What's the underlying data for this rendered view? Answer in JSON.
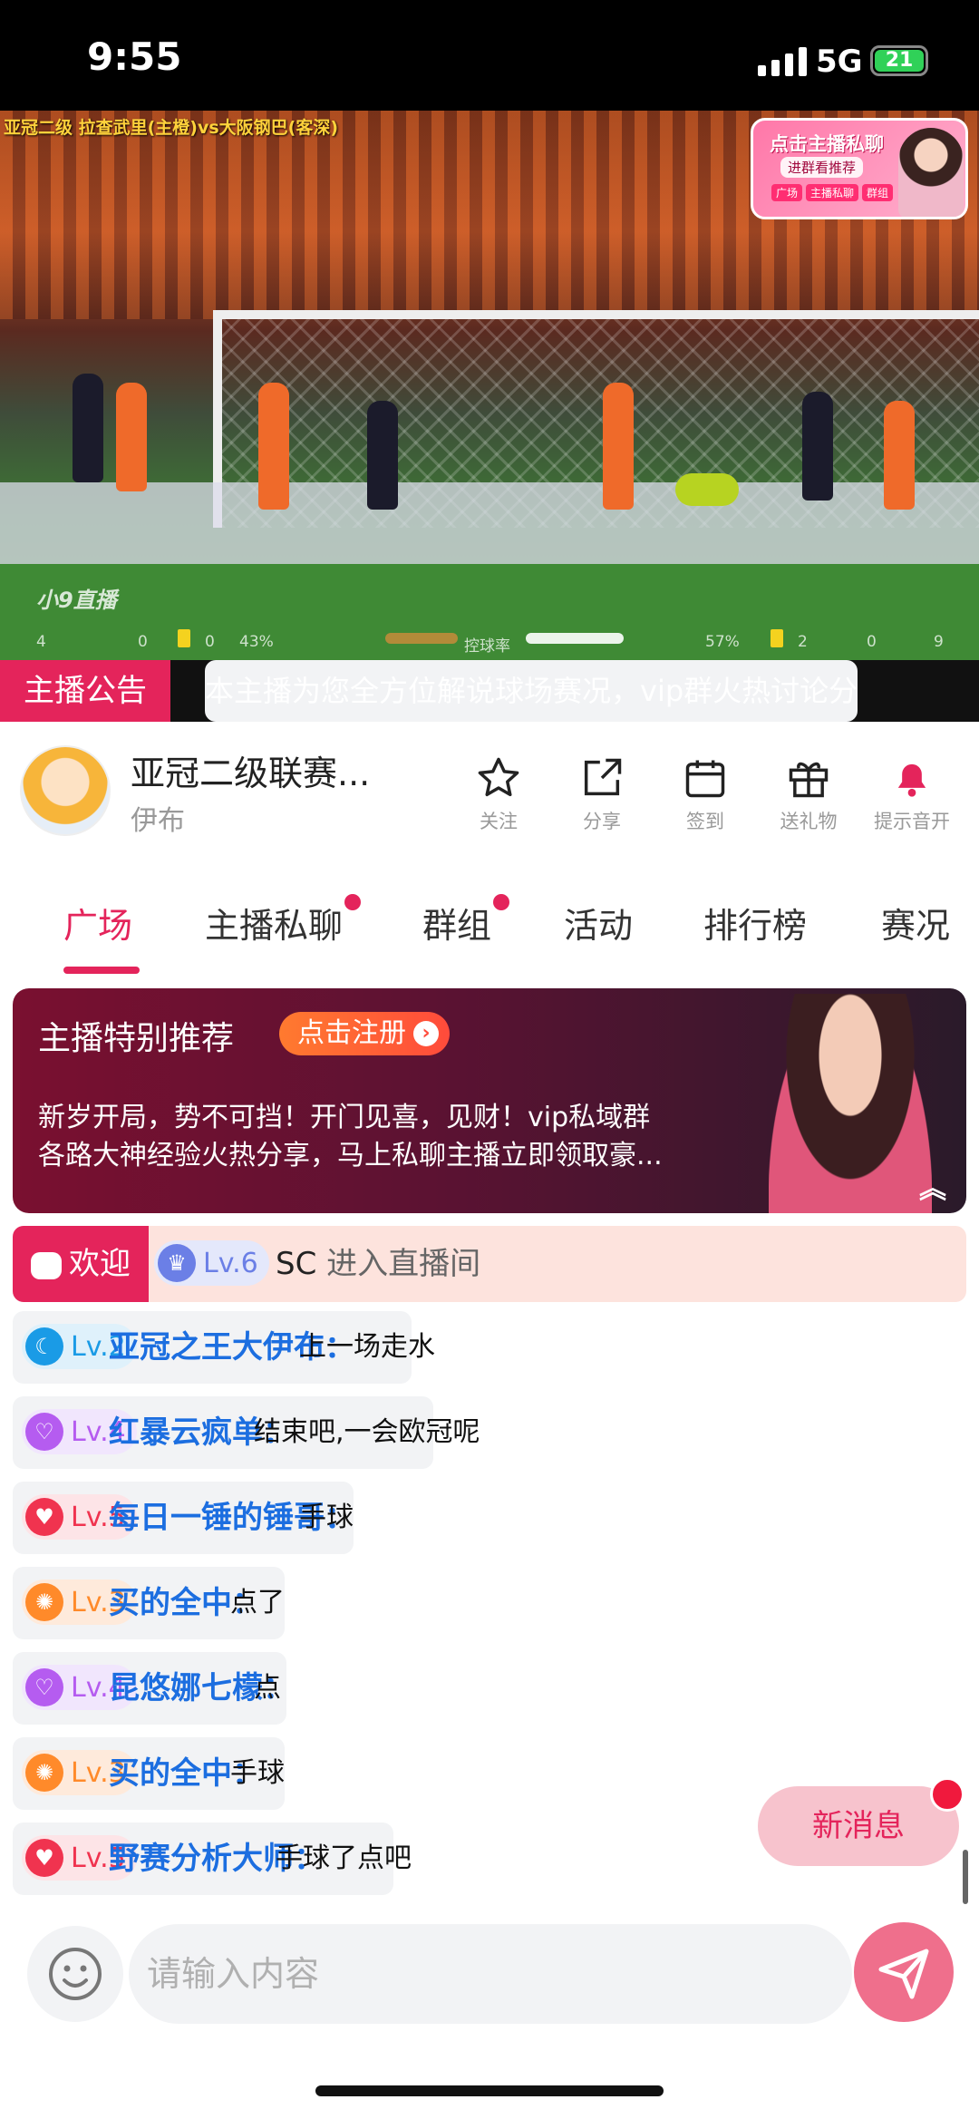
{
  "status_bar": {
    "time": "9:55",
    "network": "5G",
    "battery": "21"
  },
  "video": {
    "match_title": "亚冠二级 拉查武里(主橙)vs大阪钢巴(客深)",
    "watermark": "小9直播",
    "stats": {
      "left_corners": "4",
      "left_red": "0",
      "left_yellow": "0",
      "left_possession": "43%",
      "label": "控球率",
      "right_possession": "57%",
      "right_yellow": "2",
      "right_red": "0",
      "right_corners": "9"
    },
    "possession_left_fraction": 0.43,
    "promo": {
      "title": "点击主播私聊",
      "subtitle": "进群看推荐",
      "chips": [
        "广场",
        "主播私聊",
        "群组"
      ]
    }
  },
  "announcement": {
    "tag": "主播公告",
    "text": "本主播为您全方位解说球场赛况，vip群火热讨论分"
  },
  "channel": {
    "name": "亚冠二级联赛...",
    "host": "伊布",
    "actions": [
      {
        "label": "关注",
        "icon": "star-icon"
      },
      {
        "label": "分享",
        "icon": "share-icon"
      },
      {
        "label": "签到",
        "icon": "calendar-icon"
      },
      {
        "label": "送礼物",
        "icon": "gift-icon"
      },
      {
        "label": "提示音开",
        "icon": "bell-icon"
      }
    ]
  },
  "tabs": [
    "广场",
    "主播私聊",
    "群组",
    "活动",
    "排行榜",
    "赛况"
  ],
  "recommend": {
    "title": "主播特别推荐",
    "register": "点击注册",
    "desc_line1": "新岁开局，势不可挡！开门见喜，见财！vip私域群",
    "desc_line2": "各路大神经验火热分享，马上私聊主播立即领取豪..."
  },
  "chat": {
    "welcome": {
      "tag": "欢迎",
      "level": "Lv.6",
      "user": "SC",
      "text": "进入直播间"
    },
    "messages": [
      {
        "level": "Lv.2",
        "user": "亚冠之王大伊布：",
        "text": "上一场走水",
        "color": "#1a9be6"
      },
      {
        "level": "Lv.4",
        "user": "红暴云疯单：",
        "text": "结束吧,一会欧冠呢",
        "color": "#b55cf0"
      },
      {
        "level": "Lv.5",
        "user": "每日一锤的锤哥：",
        "text": "手球",
        "color": "#f0334f"
      },
      {
        "level": "Lv.3",
        "user": "买的全中：",
        "text": "点了",
        "color": "#ff8a2a"
      },
      {
        "level": "Lv.4",
        "user": "昆悠娜七檬：",
        "text": "点",
        "color": "#b55cf0"
      },
      {
        "level": "Lv.3",
        "user": "买的全中：",
        "text": "手球",
        "color": "#ff8a2a"
      },
      {
        "level": "Lv.5",
        "user": "野赛分析大师：",
        "text": "手球了点吧",
        "color": "#f0334f"
      }
    ],
    "new_message": "新消息"
  },
  "input": {
    "placeholder": "请输入内容"
  }
}
